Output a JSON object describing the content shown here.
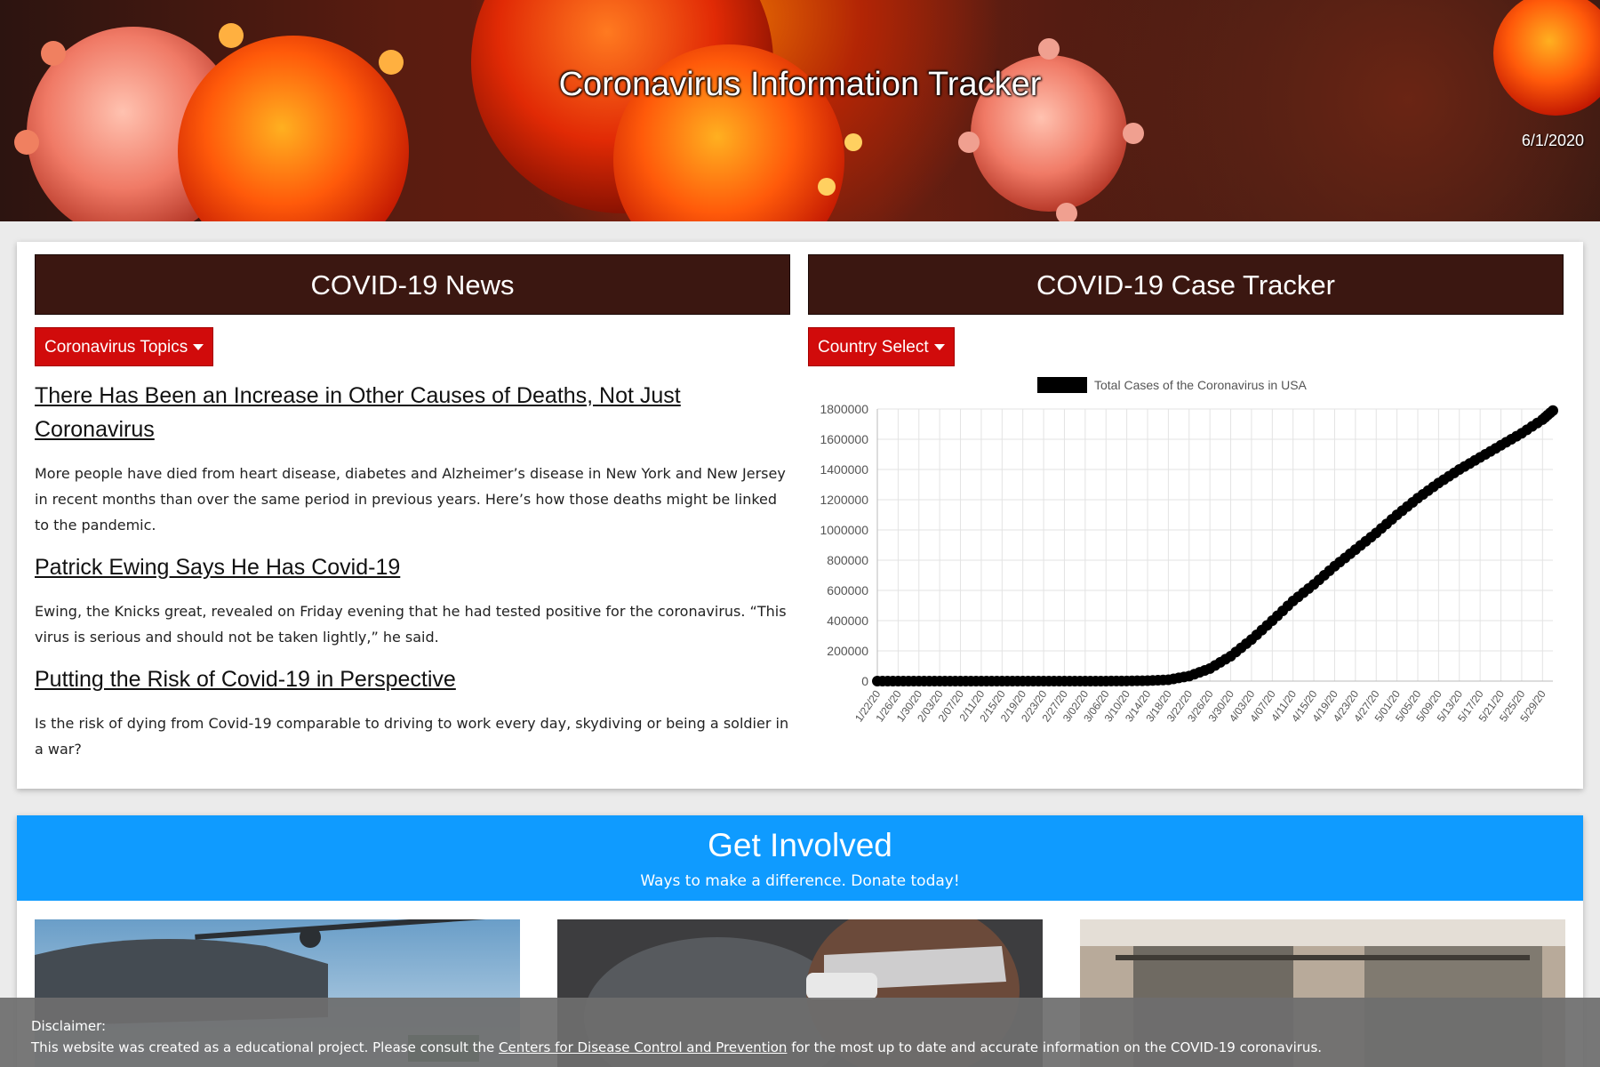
{
  "hero": {
    "title": "Coronavirus Information Tracker",
    "date": "6/1/2020"
  },
  "news": {
    "header": "COVID-19 News",
    "dropdown_label": "Coronavirus Topics",
    "articles": [
      {
        "title": "There Has Been an Increase in Other Causes of Deaths, Not Just Coronavirus",
        "summary": "More people have died from heart disease, diabetes and Alzheimer’s disease in New York and New Jersey in recent months than over the same period in previous years. Here’s how those deaths might be linked to the pandemic."
      },
      {
        "title": "Patrick Ewing Says He Has Covid-19",
        "summary": "Ewing, the Knicks great, revealed on Friday evening that he had tested positive for the coronavirus. “This virus is serious and should not be taken lightly,” he said."
      },
      {
        "title": "Putting the Risk of Covid-19 in Perspective",
        "summary": "Is the risk of dying from Covid-19 comparable to driving to work every day, skydiving or being a soldier in a war?"
      }
    ]
  },
  "tracker": {
    "header": "COVID-19 Case Tracker",
    "dropdown_label": "Country Select"
  },
  "chart_data": {
    "type": "line",
    "title": "",
    "legend": "Total Cases of the Coronavirus in USA",
    "legend_position": "top",
    "xlabel": "",
    "ylabel": "",
    "ylim": [
      0,
      1800000
    ],
    "yticks": [
      "0",
      "200000",
      "400000",
      "600000",
      "800000",
      "1000000",
      "1200000",
      "1400000",
      "1600000",
      "1800000"
    ],
    "grid": true,
    "series_color": "#000000",
    "tick_labels": [
      "1/22/20",
      "1/26/20",
      "1/30/20",
      "2/03/20",
      "2/07/20",
      "2/11/20",
      "2/15/20",
      "2/19/20",
      "2/23/20",
      "2/27/20",
      "3/02/20",
      "3/06/20",
      "3/10/20",
      "3/14/20",
      "3/18/20",
      "3/22/20",
      "3/26/20",
      "3/30/20",
      "4/03/20",
      "4/07/20",
      "4/11/20",
      "4/15/20",
      "4/19/20",
      "4/23/20",
      "4/27/20",
      "5/01/20",
      "5/05/20",
      "5/09/20",
      "5/13/20",
      "5/17/20",
      "5/21/20",
      "5/25/20",
      "5/29/20"
    ],
    "series": [
      {
        "name": "Total Cases of the Coronavirus in USA",
        "x": [
          "1/22/20",
          "1/26/20",
          "1/30/20",
          "2/03/20",
          "2/07/20",
          "2/11/20",
          "2/15/20",
          "2/19/20",
          "2/23/20",
          "2/27/20",
          "3/02/20",
          "3/06/20",
          "3/10/20",
          "3/14/20",
          "3/18/20",
          "3/22/20",
          "3/26/20",
          "3/30/20",
          "4/03/20",
          "4/07/20",
          "4/11/20",
          "4/15/20",
          "4/19/20",
          "4/23/20",
          "4/27/20",
          "5/01/20",
          "5/05/20",
          "5/09/20",
          "5/13/20",
          "5/17/20",
          "5/21/20",
          "5/25/20",
          "5/29/20",
          "5/31/20"
        ],
        "values": [
          1,
          5,
          6,
          11,
          12,
          13,
          15,
          15,
          15,
          16,
          100,
          320,
          1000,
          2900,
          9000,
          33000,
          83000,
          165000,
          275000,
          400000,
          530000,
          640000,
          760000,
          870000,
          980000,
          1100000,
          1210000,
          1310000,
          1400000,
          1480000,
          1560000,
          1640000,
          1730000,
          1790000
        ]
      }
    ]
  },
  "involved": {
    "title": "Get Involved",
    "subtitle": "Ways to make a difference. Donate today!"
  },
  "disclaimer": {
    "label": "Disclaimer:",
    "text_before": "This website was created as a educational project. Please consult the ",
    "link_text": "Centers for Disease Control and Prevention",
    "text_after": " for the most up to date and accurate information on the COVID-19 coronavirus."
  }
}
